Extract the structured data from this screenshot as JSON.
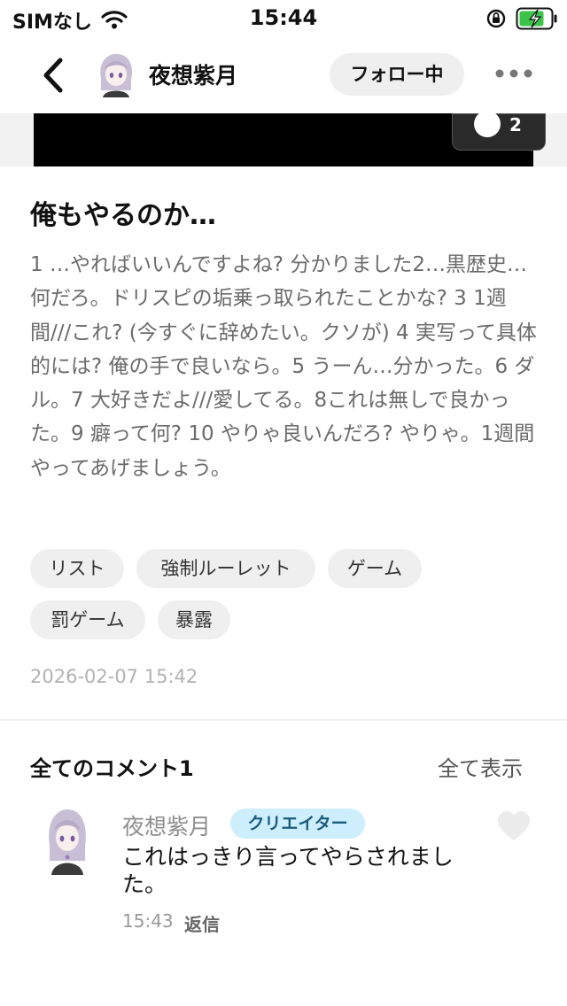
{
  "status_bar": {
    "carrier": "SIMなし",
    "time": "15:44",
    "wifi_icon": "wifi-icon",
    "lock_icon": "orientation-lock-icon",
    "battery_icon": "battery-charging-icon",
    "battery_color": "#3cc34a"
  },
  "nav": {
    "back_icon": "chevron-left-icon",
    "user_name": "夜想紫月",
    "follow_label": "フォロー中",
    "more_icon": "more-dots-icon"
  },
  "media": {
    "image_counter": "2"
  },
  "post": {
    "title": "俺もやるのか…",
    "body": "1 …やればいいんですよね? 分かりました2…黒歴史…何だろ。ドリスピの垢乗っ取られたことかな? 3 1週間///これ? (今すぐに辞めたい。クソが) 4 実写って具体的には? 俺の手で良いなら。5 うーん…分かった。6 ダル。7 大好きだよ///愛してる。8これは無しで良かった。9 癖って何? 10 やりゃ良いんだろ? やりゃ。1週間やってあげましょう。",
    "tags": [
      "リスト",
      "強制ルーレット",
      "ゲーム",
      "罰ゲーム",
      "暴露"
    ],
    "date": "2026-02-07 15:42"
  },
  "comments": {
    "title": "全てのコメント1",
    "show_all": "全て表示",
    "items": [
      {
        "author": "夜想紫月",
        "badge": "クリエイター",
        "text": "これはっきり言ってやらされました。",
        "time": "15:43",
        "reply_label": "返信",
        "like_icon": "heart-icon"
      }
    ]
  },
  "colors": {
    "badge_bg": "#cdeefd",
    "tag_bg": "#efefef",
    "text_muted": "#6b6b6b"
  }
}
